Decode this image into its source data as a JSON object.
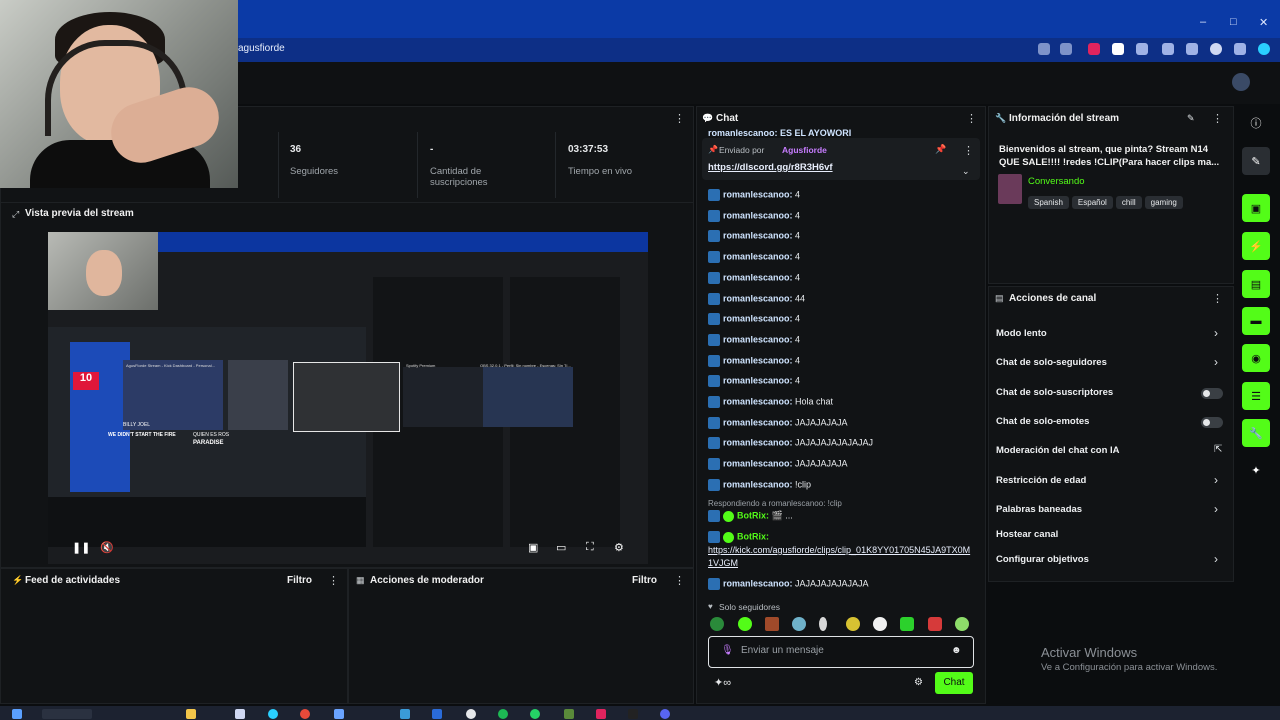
{
  "browser": {
    "url": "agusfiorde",
    "win_controls": [
      "–",
      "□",
      "✕"
    ]
  },
  "stats": [
    {
      "value": "36",
      "label": "Seguidores"
    },
    {
      "value": "-",
      "label": "Cantidad de suscripciones"
    },
    {
      "value": "03:37:53",
      "label": "Tiempo en vivo"
    }
  ],
  "preview": {
    "title": "Vista previa del stream",
    "nested_score": "10",
    "nested_texts": [
      "AgusFiorde Stream - Kick Dashboard - Personal...",
      "Spotify Premium",
      "OBS 32.0.1 - Perfil: Sin nombre - Escenas: Sin Tí..."
    ],
    "nested_game_text": "WE DIDN'T START THE FIRE",
    "nested_paradise": "PARADISE",
    "nested_billy": "BILLY JOEL",
    "nested_quien": "QUIEN ES ROS"
  },
  "activity": {
    "title": "Feed de actividades",
    "filter": "Filtro"
  },
  "moderator": {
    "title": "Acciones de moderador",
    "filter": "Filtro"
  },
  "chat": {
    "title": "Chat",
    "top_line": "romanlescanoo: ES EL AYOWORI",
    "pinned_by_label": "Enviado por",
    "pinned_by_user": "Agusfiorde",
    "pinned_link": "https://dlscord.gg/r8R3H6vf",
    "messages": [
      {
        "user": "romanlescanoo",
        "text": "4"
      },
      {
        "user": "romanlescanoo",
        "text": "4"
      },
      {
        "user": "romanlescanoo",
        "text": "4"
      },
      {
        "user": "romanlescanoo",
        "text": "4"
      },
      {
        "user": "romanlescanoo",
        "text": "4"
      },
      {
        "user": "romanlescanoo",
        "text": "44"
      },
      {
        "user": "romanlescanoo",
        "text": "4"
      },
      {
        "user": "romanlescanoo",
        "text": "4"
      },
      {
        "user": "romanlescanoo",
        "text": "4"
      },
      {
        "user": "romanlescanoo",
        "text": "4"
      },
      {
        "user": "romanlescanoo",
        "text": "Hola chat"
      },
      {
        "user": "romanlescanoo",
        "text": "JAJAJAJAJA"
      },
      {
        "user": "romanlescanoo",
        "text": "JAJAJAJAJAJAJAJ"
      },
      {
        "user": "romanlescanoo",
        "text": "JAJAJAJAJA"
      },
      {
        "user": "romanlescanoo",
        "text": "!clip"
      }
    ],
    "reply_label": "Respondiendo a romanlescanoo: !clip",
    "bot1_user": "BotRix:",
    "bot1_text": "🎬 ...",
    "bot2_user": "BotRix:",
    "bot2_link": "https://kick.com/agusfiorde/clips/clip_01K8YY01705N45JA9TX0M1VJGM",
    "last_user": "romanlescanoo",
    "last_text": "JAJAJAJAJAJAJA",
    "mode_label": "Solo seguidores",
    "input_placeholder": "Enviar un mensaje",
    "send_button": "Chat"
  },
  "stream_info": {
    "title": "Información del stream",
    "stream_title": "Bienvenidos al stream, que pinta? Stream N14 QUE SALE!!!! !redes !CLIP(Para hacer clips ma...",
    "category": "Conversando",
    "tags": [
      "Spanish",
      "Español",
      "chill",
      "gaming"
    ]
  },
  "channel_actions": {
    "title": "Acciones de canal",
    "items": [
      {
        "label": "Modo lento",
        "control": "chevron"
      },
      {
        "label": "Chat de solo-seguidores",
        "control": "chevron"
      },
      {
        "label": "Chat de solo-suscriptores",
        "control": "toggle"
      },
      {
        "label": "Chat de solo-emotes",
        "control": "toggle"
      },
      {
        "label": "Moderación del chat con IA",
        "control": "external"
      },
      {
        "label": "Restricción de edad",
        "control": "chevron"
      },
      {
        "label": "Palabras baneadas",
        "control": "chevron"
      },
      {
        "label": "Hostear canal",
        "control": "none"
      },
      {
        "label": "Configurar objetivos",
        "control": "chevron"
      }
    ]
  },
  "windows_watermark": {
    "line1": "Activar Windows",
    "line2": "Ve a Configuración para activar Windows."
  },
  "colors": {
    "accent": "#53fc18",
    "panel": "#111315",
    "browser": "#0b3aa6"
  }
}
